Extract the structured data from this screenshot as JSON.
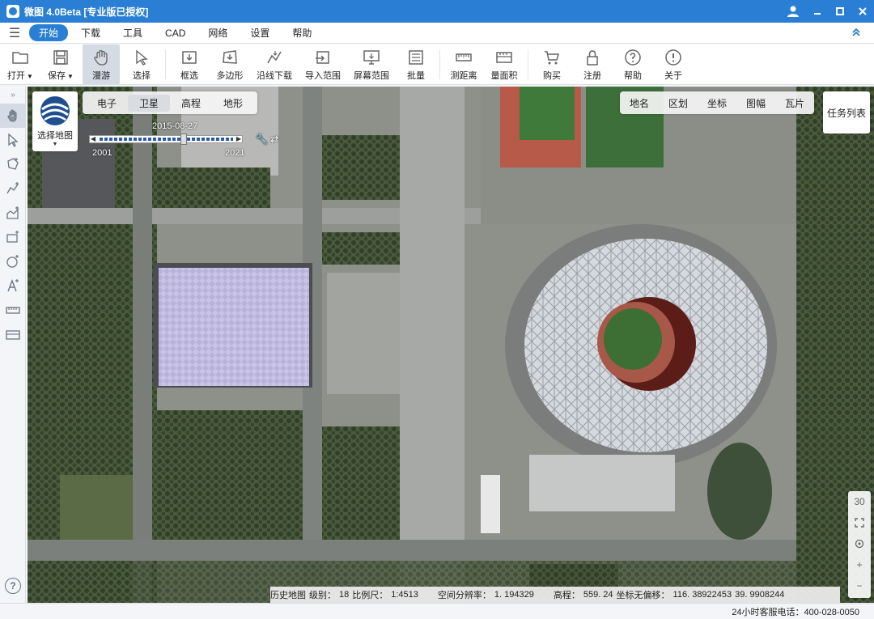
{
  "app": {
    "title": "微图 4.0Beta [专业版已授权]"
  },
  "menu": {
    "items": [
      "开始",
      "下载",
      "工具",
      "CAD",
      "网络",
      "设置",
      "帮助"
    ],
    "active": "开始"
  },
  "toolbar": {
    "open_label": "打开",
    "save_label": "保存",
    "pan_label": "漫游",
    "select_label": "选择",
    "box_select_label": "框选",
    "polygon_label": "多边形",
    "line_download_label": "沿线下载",
    "import_range_label": "导入范围",
    "screen_range_label": "屏幕范围",
    "batch_label": "批量",
    "measure_distance_label": "测距离",
    "measure_area_label": "量面积",
    "buy_label": "购买",
    "register_label": "注册",
    "help_label": "帮助",
    "about_label": "关于"
  },
  "map": {
    "selector_label": "选择地图",
    "layer_tabs": [
      "电子",
      "卫星",
      "高程",
      "地形"
    ],
    "active_layer": "卫星",
    "overlay_tabs": [
      "地名",
      "区划",
      "坐标",
      "图幅",
      "瓦片"
    ],
    "task_list_label": "任务列表",
    "timeline": {
      "date": "2015-08-27",
      "start_year": "2001",
      "end_year": "2021"
    },
    "zoom": {
      "level_3d": "30",
      "zoom_in": "+",
      "zoom_out": "−"
    }
  },
  "status": {
    "history_map": "历史地图",
    "level_label": "级别：",
    "level_value": "18",
    "scale_label": "比例尺：",
    "scale_value": "1:4513",
    "resolution_label": "空间分辨率：",
    "resolution_value": "1. 194329",
    "elevation_label": "高程：",
    "elevation_value": "559. 24",
    "coord_label": "坐标无偏移：",
    "lon_value": "116. 38922453",
    "lat_value": "39. 9908244"
  },
  "footer": {
    "hotline": "24小时客服电话：400-028-0050"
  },
  "colors": {
    "accent": "#2a7fd4",
    "toolbar_active": "#d4dbe4"
  }
}
